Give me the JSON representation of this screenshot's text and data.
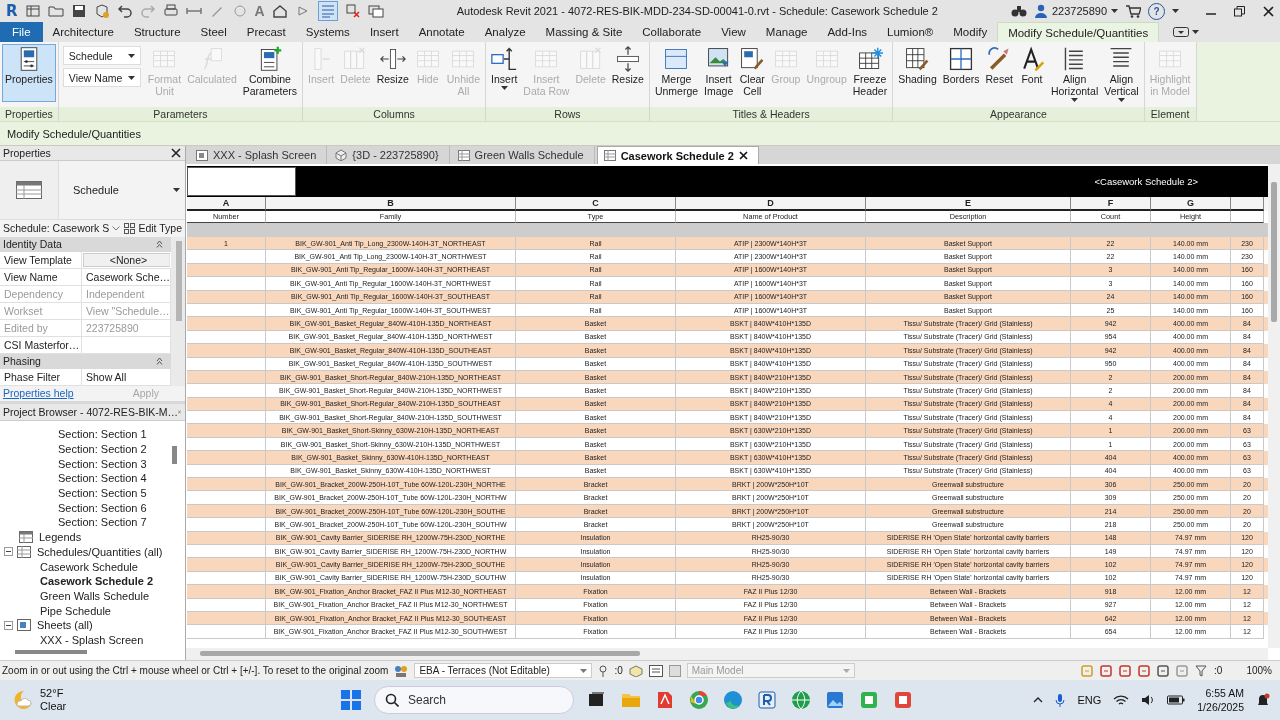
{
  "title_bar": {
    "logo": "R",
    "text_tool": "A",
    "toggle_on": true,
    "title": "Autodesk Revit 2021 - 4072-RES-BIK-MDD-234-SD-00041-0.rvt - Schedule: Casework Schedule 2",
    "user": "223725890",
    "help": "?"
  },
  "ribbon_tabs": [
    {
      "label": "File",
      "kind": "file",
      "selected": false
    },
    {
      "label": "Architecture",
      "kind": "tab",
      "selected": false
    },
    {
      "label": "Structure",
      "kind": "tab",
      "selected": false
    },
    {
      "label": "Steel",
      "kind": "tab",
      "selected": false
    },
    {
      "label": "Precast",
      "kind": "tab",
      "selected": false
    },
    {
      "label": "Systems",
      "kind": "tab",
      "selected": false
    },
    {
      "label": "Insert",
      "kind": "tab",
      "selected": false
    },
    {
      "label": "Annotate",
      "kind": "tab",
      "selected": false
    },
    {
      "label": "Analyze",
      "kind": "tab",
      "selected": false
    },
    {
      "label": "Massing & Site",
      "kind": "tab",
      "selected": false
    },
    {
      "label": "Collaborate",
      "kind": "tab",
      "selected": false
    },
    {
      "label": "View",
      "kind": "tab",
      "selected": false
    },
    {
      "label": "Manage",
      "kind": "tab",
      "selected": false
    },
    {
      "label": "Add-Ins",
      "kind": "tab",
      "selected": false
    },
    {
      "label": "Lumion®",
      "kind": "tab",
      "selected": false
    },
    {
      "label": "Modify",
      "kind": "tab",
      "selected": false
    },
    {
      "label": "Modify Schedule/Quantities",
      "kind": "tab",
      "selected": true
    }
  ],
  "ribbon_panels": [
    {
      "label": "Properties",
      "items": [
        {
          "kind": "button",
          "label": "Properties",
          "disabled": false,
          "on": true
        }
      ]
    },
    {
      "label": "Parameters",
      "items": [
        {
          "kind": "combo",
          "value": "Schedule"
        },
        {
          "kind": "combo",
          "value": "View Name"
        },
        {
          "kind": "button",
          "label": "Format\nUnit",
          "disabled": true,
          "on": false
        },
        {
          "kind": "button",
          "label": "Calculated",
          "disabled": true,
          "on": false
        },
        {
          "kind": "button",
          "label": "Combine\nParameters",
          "disabled": false,
          "on": false
        }
      ]
    },
    {
      "label": "Columns",
      "items": [
        {
          "kind": "button",
          "label": "Insert",
          "disabled": true,
          "on": false
        },
        {
          "kind": "button",
          "label": "Delete",
          "disabled": true,
          "on": false
        },
        {
          "kind": "button",
          "label": "Resize",
          "disabled": false,
          "on": false
        },
        {
          "kind": "button",
          "label": "Hide",
          "disabled": true,
          "on": false
        },
        {
          "kind": "button",
          "label": "Unhide\nAll",
          "disabled": true,
          "on": false
        }
      ]
    },
    {
      "label": "Rows",
      "items": [
        {
          "kind": "split",
          "label": "Insert",
          "disabled": false,
          "on": false
        },
        {
          "kind": "button",
          "label": "Insert\nData Row",
          "disabled": true,
          "on": false
        },
        {
          "kind": "button",
          "label": "Delete",
          "disabled": true,
          "on": false
        },
        {
          "kind": "button",
          "label": "Resize",
          "disabled": false,
          "on": false
        }
      ]
    },
    {
      "label": "Titles & Headers",
      "items": [
        {
          "kind": "button",
          "label": "Merge\nUnmerge",
          "disabled": false,
          "on": false
        },
        {
          "kind": "button",
          "label": "Insert\nImage",
          "disabled": false,
          "on": false
        },
        {
          "kind": "button",
          "label": "Clear\nCell",
          "disabled": false,
          "on": false
        },
        {
          "kind": "button",
          "label": "Group",
          "disabled": true,
          "on": false
        },
        {
          "kind": "button",
          "label": "Ungroup",
          "disabled": true,
          "on": false
        },
        {
          "kind": "button",
          "label": "Freeze\nHeader",
          "disabled": false,
          "on": false
        }
      ]
    },
    {
      "label": "Appearance",
      "items": [
        {
          "kind": "button",
          "label": "Shading",
          "disabled": false,
          "on": false
        },
        {
          "kind": "button",
          "label": "Borders",
          "disabled": false,
          "on": false
        },
        {
          "kind": "button",
          "label": "Reset",
          "disabled": false,
          "on": false
        },
        {
          "kind": "button",
          "label": "Font",
          "disabled": false,
          "on": false
        },
        {
          "kind": "split",
          "label": "Align\nHorizontal",
          "disabled": false,
          "on": false
        },
        {
          "kind": "split",
          "label": "Align\nVertical",
          "disabled": false,
          "on": false
        }
      ]
    },
    {
      "label": "Element",
      "items": [
        {
          "kind": "button",
          "label": "Highlight\nin Model",
          "disabled": true,
          "on": false
        }
      ]
    }
  ],
  "options_bar": {
    "label": "Modify Schedule/Quantities"
  },
  "properties": {
    "title": "Properties",
    "type_name": "Schedule",
    "instance_selector": "Schedule: Casework S",
    "edit_type": "Edit Type",
    "groups": [
      {
        "label": "Identity Data",
        "rows": [
          {
            "name": "View Template",
            "value": "<None>",
            "kind": "button",
            "disabled": false
          },
          {
            "name": "View Name",
            "value": "Casework Sche…",
            "kind": "text",
            "disabled": false
          },
          {
            "name": "Dependency",
            "value": "Independent",
            "kind": "text",
            "disabled": true
          },
          {
            "name": "Workset",
            "value": "View \"Schedule…",
            "kind": "text",
            "disabled": true
          },
          {
            "name": "Edited by",
            "value": "223725890",
            "kind": "text",
            "disabled": true
          },
          {
            "name": "CSI Masterfor…",
            "kind": "text",
            "disabled": false
          }
        ]
      },
      {
        "label": "Phasing",
        "rows": [
          {
            "name": "Phase Filter",
            "value": "Show All",
            "kind": "text",
            "disabled": false
          }
        ]
      }
    ],
    "help_link": "Properties help",
    "apply": {
      "label": "Apply",
      "disabled": true
    }
  },
  "project_browser": {
    "title": "Project Browser - 4072-RES-BIK-M…",
    "continued_items": [
      {
        "label": "Section: Section 1",
        "selected": false
      },
      {
        "label": "Section: Section 2",
        "selected": false
      },
      {
        "label": "Section: Section 3",
        "selected": false
      },
      {
        "label": "Section: Section 4",
        "selected": false
      },
      {
        "label": "Section: Section 5",
        "selected": false
      },
      {
        "label": "Section: Section 6",
        "selected": false
      },
      {
        "label": "Section: Section 7",
        "selected": false
      }
    ],
    "items": [
      {
        "label": "Legends",
        "kind": "legends",
        "selected": false
      },
      {
        "label": "Schedules/Quantities (all)",
        "kind": "schedules",
        "expanded": true,
        "selected": false,
        "children": [
          {
            "label": "Casework Schedule",
            "selected": false
          },
          {
            "label": "Casework Schedule 2",
            "selected": true
          },
          {
            "label": "Green Walls Schedule",
            "selected": false
          },
          {
            "label": "Pipe Schedule",
            "selected": false
          }
        ]
      },
      {
        "label": "Sheets (all)",
        "kind": "sheets",
        "expanded": true,
        "selected": false,
        "children": [
          {
            "label": "XXX - Splash Screen",
            "selected": false
          }
        ]
      }
    ]
  },
  "view_tabs": [
    {
      "label": "XXX - Splash Screen",
      "kind": "sheet",
      "selected": false
    },
    {
      "label": "{3D - 223725890}",
      "kind": "model",
      "selected": false
    },
    {
      "label": "Green Walls Schedule",
      "kind": "schedule",
      "selected": false
    },
    {
      "label": "Casework Schedule 2",
      "kind": "schedule",
      "selected": true
    }
  ],
  "schedule": {
    "title": "<Casework Schedule 2>",
    "columns": [
      {
        "letter": "A",
        "name": "Number"
      },
      {
        "letter": "B",
        "name": "Family"
      },
      {
        "letter": "C",
        "name": "Type"
      },
      {
        "letter": "D",
        "name": "Name of Product"
      },
      {
        "letter": "E",
        "name": "Description"
      },
      {
        "letter": "F",
        "name": "Count"
      },
      {
        "letter": "G",
        "name": "Height"
      }
    ],
    "rows": [
      {
        "shaded": true,
        "number": "1",
        "family": "BIK_GW-901_Anti Tip_Long_2300W-140H-3T_NORTHEAST",
        "type": "Rail",
        "product": "ATIP | 2300W*140H*3T",
        "description": "Basket Support",
        "count": "22",
        "height": "140.00 mm",
        "column_8": "230"
      },
      {
        "shaded": false,
        "family": "BIK_GW-901_Anti Tip_Long_2300W-140H-3T_NORTHWEST",
        "type": "Rail",
        "product": "ATIP | 2300W*140H*3T",
        "description": "Basket Support",
        "count": "22",
        "height": "140.00 mm",
        "column_8": "230"
      },
      {
        "shaded": true,
        "family": "BIK_GW-901_Anti Tip_Regular_1600W-140H-3T_NORTHEAST",
        "type": "Rail",
        "product": "ATIP | 1600W*140H*3T",
        "description": "Basket Support",
        "count": "3",
        "height": "140.00 mm",
        "column_8": "160"
      },
      {
        "shaded": false,
        "family": "BIK_GW-901_Anti Tip_Regular_1600W-140H-3T_NORTHWEST",
        "type": "Rail",
        "product": "ATIP | 1600W*140H*3T",
        "description": "Basket Support",
        "count": "3",
        "height": "140.00 mm",
        "column_8": "160"
      },
      {
        "shaded": true,
        "family": "BIK_GW-901_Anti Tip_Regular_1600W-140H-3T_SOUTHEAST",
        "type": "Rail",
        "product": "ATIP | 1600W*140H*3T",
        "description": "Basket Support",
        "count": "24",
        "height": "140.00 mm",
        "column_8": "160"
      },
      {
        "shaded": false,
        "family": "BIK_GW-901_Anti Tip_Regular_1600W-140H-3T_SOUTHWEST",
        "type": "Rail",
        "product": "ATIP | 1600W*140H*3T",
        "description": "Basket Support",
        "count": "25",
        "height": "140.00 mm",
        "column_8": "160"
      },
      {
        "shaded": true,
        "family": "BIK_GW-901_Basket_Regular_840W-410H-135D_NORTHEAST",
        "type": "Basket",
        "product": "BSKT | 840W*410H*135D",
        "description": "Tissu/ Substrate (Tracer)/ Grid (Stainless)",
        "count": "942",
        "height": "400.00 mm",
        "column_8": "84"
      },
      {
        "shaded": false,
        "family": "BIK_GW-901_Basket_Regular_840W-410H-135D_NORTHWEST",
        "type": "Basket",
        "product": "BSKT | 840W*410H*135D",
        "description": "Tissu/ Substrate (Tracer)/ Grid (Stainless)",
        "count": "954",
        "height": "400.00 mm",
        "column_8": "84"
      },
      {
        "shaded": true,
        "family": "BIK_GW-901_Basket_Regular_840W-410H-135D_SOUTHEAST",
        "type": "Basket",
        "product": "BSKT | 840W*410H*135D",
        "description": "Tissu/ Substrate (Tracer)/ Grid (Stainless)",
        "count": "942",
        "height": "400.00 mm",
        "column_8": "84"
      },
      {
        "shaded": false,
        "family": "BIK_GW-901_Basket_Regular_840W-410H-135D_SOUTHWEST",
        "type": "Basket",
        "product": "BSKT | 840W*410H*135D",
        "description": "Tissu/ Substrate (Tracer)/ Grid (Stainless)",
        "count": "950",
        "height": "400.00 mm",
        "column_8": "84"
      },
      {
        "shaded": true,
        "family": "BIK_GW-901_Basket_Short-Regular_840W-210H-135D_NORTHEAST",
        "type": "Basket",
        "product": "BSKT | 840W*210H*135D",
        "description": "Tissu/ Substrate (Tracer)/ Grid (Stainless)",
        "count": "2",
        "height": "200.00 mm",
        "column_8": "84"
      },
      {
        "shaded": false,
        "family": "BIK_GW-901_Basket_Short-Regular_840W-210H-135D_NORTHWEST",
        "type": "Basket",
        "product": "BSKT | 840W*210H*135D",
        "description": "Tissu/ Substrate (Tracer)/ Grid (Stainless)",
        "count": "2",
        "height": "200.00 mm",
        "column_8": "84"
      },
      {
        "shaded": true,
        "family": "BIK_GW-901_Basket_Short-Regular_840W-210H-135D_SOUTHEAST",
        "type": "Basket",
        "product": "BSKT | 840W*210H*135D",
        "description": "Tissu/ Substrate (Tracer)/ Grid (Stainless)",
        "count": "4",
        "height": "200.00 mm",
        "column_8": "84"
      },
      {
        "shaded": false,
        "family": "BIK_GW-901_Basket_Short-Regular_840W-210H-135D_SOUTHWEST",
        "type": "Basket",
        "product": "BSKT | 840W*210H*135D",
        "description": "Tissu/ Substrate (Tracer)/ Grid (Stainless)",
        "count": "4",
        "height": "200.00 mm",
        "column_8": "84"
      },
      {
        "shaded": true,
        "family": "BIK_GW-901_Basket_Short-Skinny_630W-210H-135D_NORTHEAST",
        "type": "Basket",
        "product": "BSKT | 630W*210H*135D",
        "description": "Tissu/ Substrate (Tracer)/ Grid (Stainless)",
        "count": "1",
        "height": "200.00 mm",
        "column_8": "63"
      },
      {
        "shaded": false,
        "family": "BIK_GW-901_Basket_Short-Skinny_630W-210H-135D_NORTHWEST",
        "type": "Basket",
        "product": "BSKT | 630W*210H*135D",
        "description": "Tissu/ Substrate (Tracer)/ Grid (Stainless)",
        "count": "1",
        "height": "200.00 mm",
        "column_8": "63"
      },
      {
        "shaded": true,
        "family": "BIK_GW-901_Basket_Skinny_630W-410H-135D_NORTHEAST",
        "type": "Basket",
        "product": "BSKT | 630W*410H*135D",
        "description": "Tissu/ Substrate (Tracer)/ Grid (Stainless)",
        "count": "404",
        "height": "400.00 mm",
        "column_8": "63"
      },
      {
        "shaded": false,
        "family": "BIK_GW-901_Basket_Skinny_630W-410H-135D_NORTHWEST",
        "type": "Basket",
        "product": "BSKT | 630W*410H*135D",
        "description": "Tissu/ Substrate (Tracer)/ Grid (Stainless)",
        "count": "404",
        "height": "400.00 mm",
        "column_8": "63"
      },
      {
        "shaded": true,
        "family": "BIK_GW-901_Bracket_200W-250H-10T_Tube 60W-120L-230H_NORTHE",
        "type": "Bracket",
        "product": "BRKT | 200W*250H*10T",
        "description": "Greenwall substructure",
        "count": "306",
        "height": "250.00 mm",
        "column_8": "20"
      },
      {
        "shaded": false,
        "family": "BIK_GW-901_Bracket_200W-250H-10T_Tube 60W-120L-230H_NORTHW",
        "type": "Bracket",
        "product": "BRKT | 200W*250H*10T",
        "description": "Greenwall substructure",
        "count": "309",
        "height": "250.00 mm",
        "column_8": "20"
      },
      {
        "shaded": true,
        "family": "BIK_GW-901_Bracket_200W-250H-10T_Tube 60W-120L-230H_SOUTHE",
        "type": "Bracket",
        "product": "BRKT | 200W*250H*10T",
        "description": "Greenwall substructure",
        "count": "214",
        "height": "250.00 mm",
        "column_8": "20"
      },
      {
        "shaded": false,
        "family": "BIK_GW-901_Bracket_200W-250H-10T_Tube 60W-120L-230H_SOUTHW",
        "type": "Bracket",
        "product": "BRKT | 200W*250H*10T",
        "description": "Greenwall substructure",
        "count": "218",
        "height": "250.00 mm",
        "column_8": "20"
      },
      {
        "shaded": true,
        "family": "BIK_GW-901_Cavity Barrier_SIDERISE RH_1200W-75H-230D_NORTHE",
        "type": "Insulation",
        "product": "RH25-90/30",
        "description": "SIDERISE RH 'Open State' horizontal cavity barriers",
        "count": "148",
        "height": "74.97 mm",
        "column_8": "120"
      },
      {
        "shaded": false,
        "family": "BIK_GW-901_Cavity Barrier_SIDERISE RH_1200W-75H-230D_NORTHW",
        "type": "Insulation",
        "product": "RH25-90/30",
        "description": "SIDERISE RH 'Open State' horizontal cavity barriers",
        "count": "149",
        "height": "74.97 mm",
        "column_8": "120"
      },
      {
        "shaded": true,
        "family": "BIK_GW-901_Cavity Barrier_SIDERISE RH_1200W-75H-230D_SOUTHE",
        "type": "Insulation",
        "product": "RH25-90/30",
        "description": "SIDERISE RH 'Open State' horizontal cavity barriers",
        "count": "102",
        "height": "74.97 mm",
        "column_8": "120"
      },
      {
        "shaded": false,
        "family": "BIK_GW-901_Cavity Barrier_SIDERISE RH_1200W-75H-230D_SOUTHW",
        "type": "Insulation",
        "product": "RH25-90/30",
        "description": "SIDERISE RH 'Open State' horizontal cavity barriers",
        "count": "102",
        "height": "74.97 mm",
        "column_8": "120"
      },
      {
        "shaded": true,
        "family": "BIK_GW-901_Fixation_Anchor Bracket_FAZ II Plus M12-30_NORTHEAST",
        "type": "Fixation",
        "product": "FAZ II Plus 12/30",
        "description": "Between Wall - Brackets",
        "count": "918",
        "height": "12.00 mm",
        "column_8": "12"
      },
      {
        "shaded": false,
        "family": "BIK_GW-901_Fixation_Anchor Bracket_FAZ II Plus M12-30_NORTHWEST",
        "type": "Fixation",
        "product": "FAZ II Plus 12/30",
        "description": "Between Wall - Brackets",
        "count": "927",
        "height": "12.00 mm",
        "column_8": "12"
      },
      {
        "shaded": true,
        "family": "BIK_GW-901_Fixation_Anchor Bracket_FAZ II Plus M12-30_SOUTHEAST",
        "type": "Fixation",
        "product": "FAZ II Plus 12/30",
        "description": "Between Wall - Brackets",
        "count": "642",
        "height": "12.00 mm",
        "column_8": "12"
      },
      {
        "shaded": false,
        "family": "BIK_GW-901_Fixation_Anchor Bracket_FAZ II Plus M12-30_SOUTHWEST",
        "type": "Fixation",
        "product": "FAZ II Plus 12/30",
        "description": "Between Wall - Brackets",
        "count": "654",
        "height": "12.00 mm",
        "column_8": "12"
      }
    ]
  },
  "status_bar": {
    "hint": "Zoom in or out using the Ctrl + mouse wheel or Ctrl + [+/-]. To reset to the original zoom",
    "workset": "EBA - Terraces (Not Editable)",
    "editable_count": ":0",
    "filter_count": ":0",
    "design_option": {
      "value": "Main Model",
      "disabled": true
    },
    "zoom": "100%"
  },
  "taskbar": {
    "temperature": "52°F",
    "condition": "Clear",
    "search_placeholder": "Search",
    "language": "ENG",
    "time": "6:55 AM",
    "date": "1/26/2025"
  }
}
